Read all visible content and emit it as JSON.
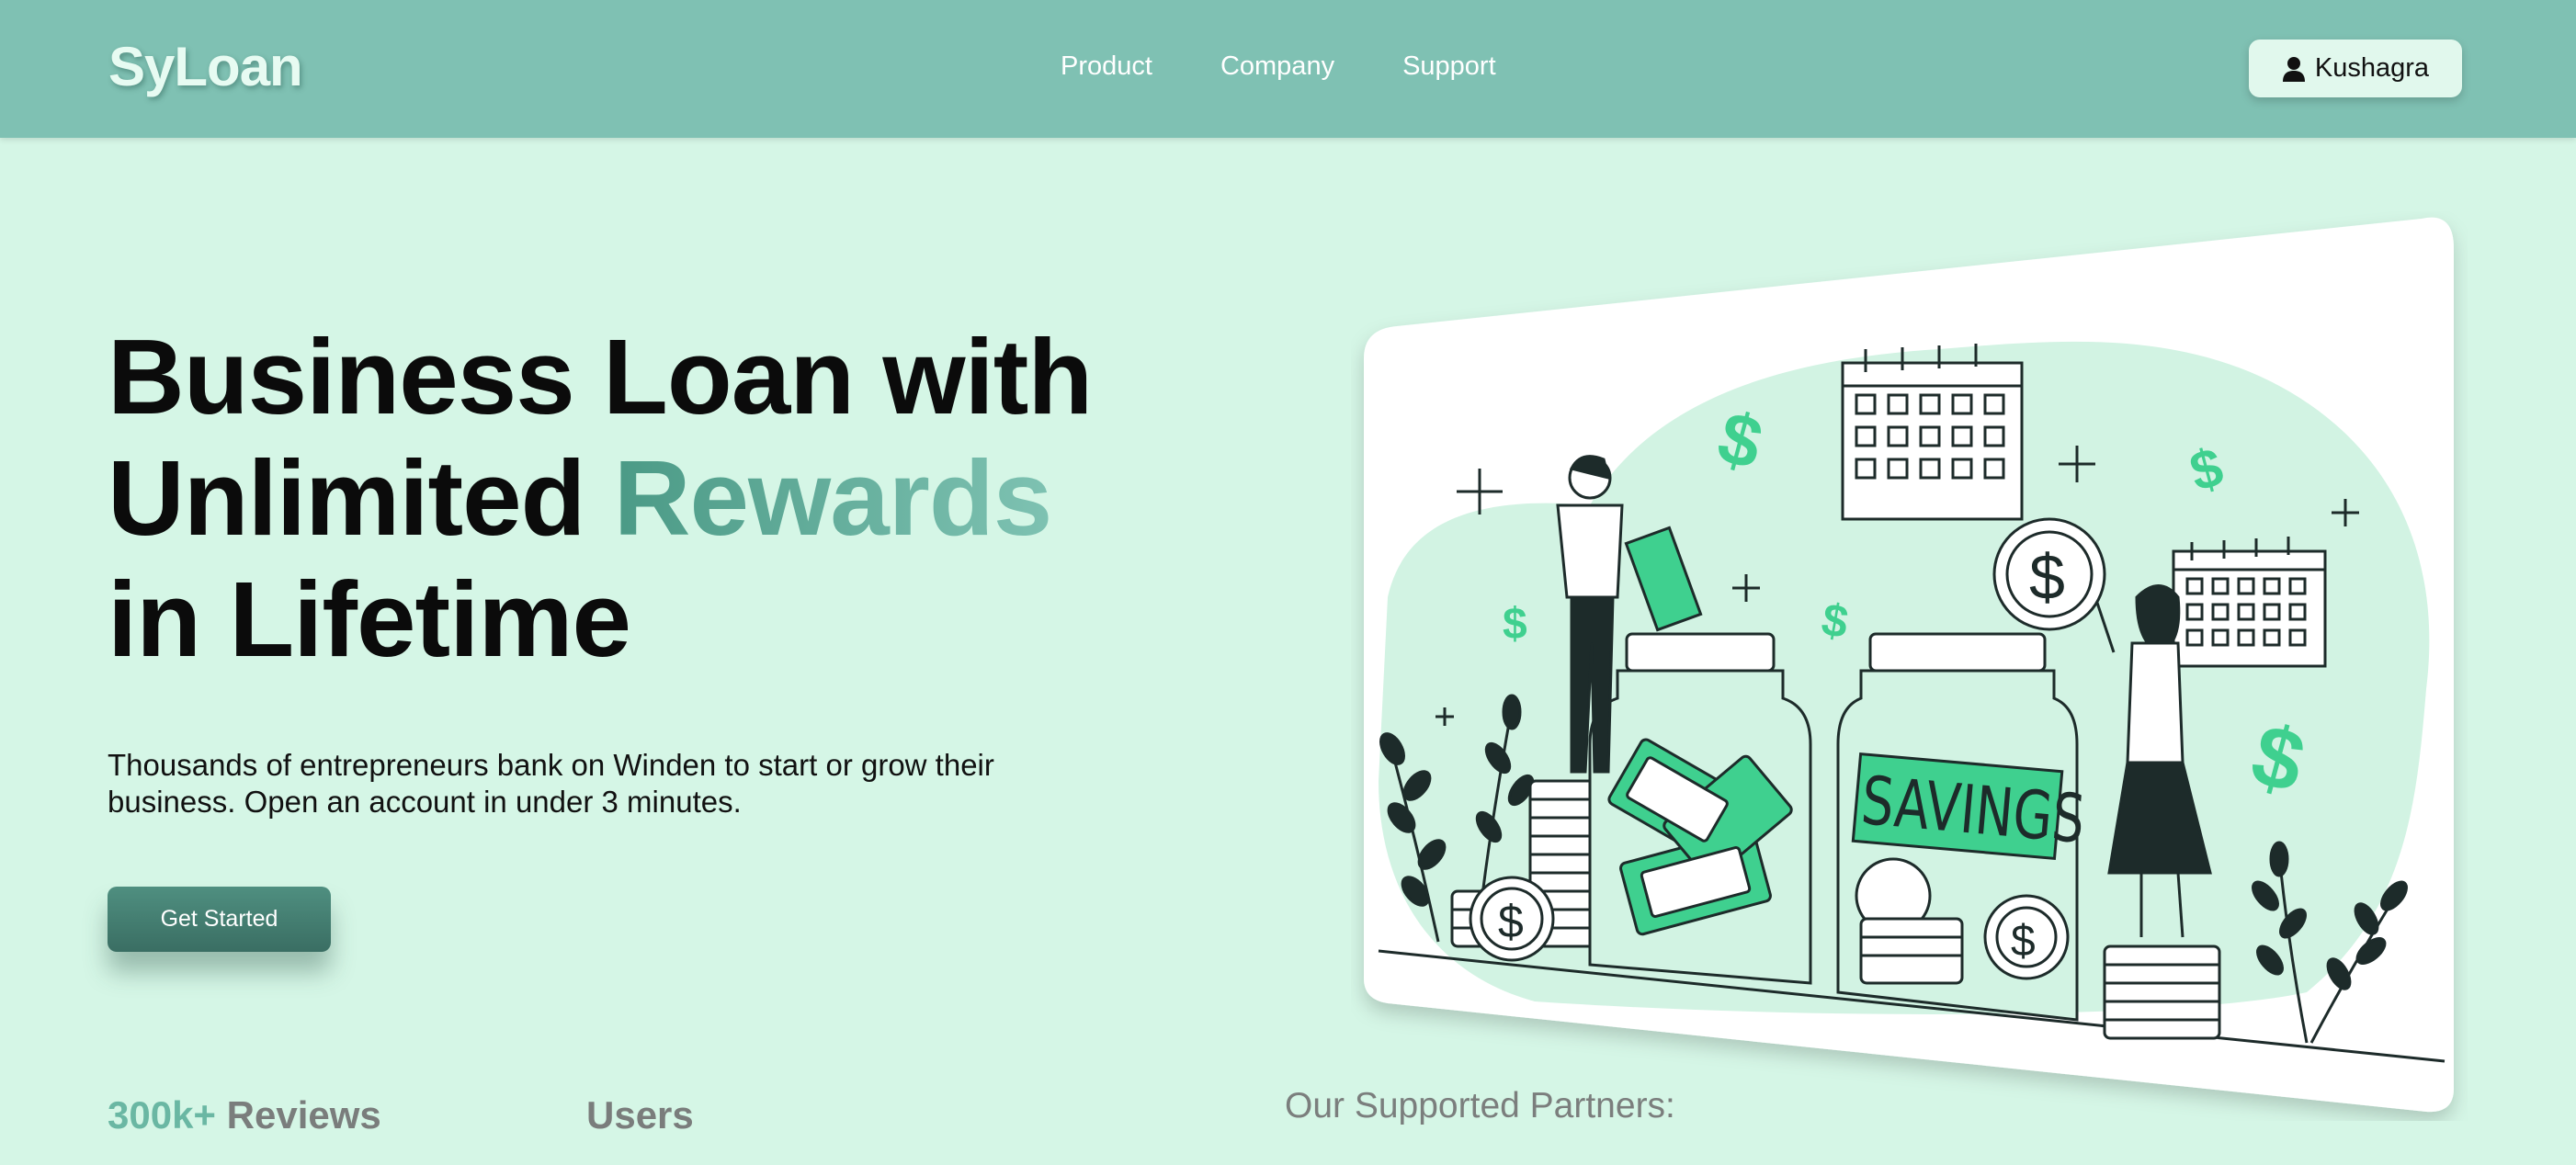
{
  "header": {
    "logo": "SyLoan",
    "nav": [
      "Product",
      "Company",
      "Support"
    ],
    "user_name": "Kushagra",
    "user_icon": "person-icon"
  },
  "hero": {
    "title_line1": "Business Loan with",
    "title_line2_plain": "Unlimited",
    "title_line2_accent": "Rewards",
    "title_line3": "in Lifetime",
    "subtitle": "Thousands of entrepreneurs bank on Winden to start or grow their business. Open an account in under 3 minutes.",
    "cta_label": "Get Started"
  },
  "stats": {
    "reviews_number": "300k+",
    "reviews_label": "Reviews",
    "users_label": "Users"
  },
  "partners_label": "Our Supported Partners:",
  "illustration": {
    "jar_label": "SAVINGS"
  },
  "colors": {
    "page_bg": "#d5f6e6",
    "header_bg": "#7fc1b3",
    "accent_green": "#3fd08f",
    "cta_bg": "#4a8577"
  }
}
